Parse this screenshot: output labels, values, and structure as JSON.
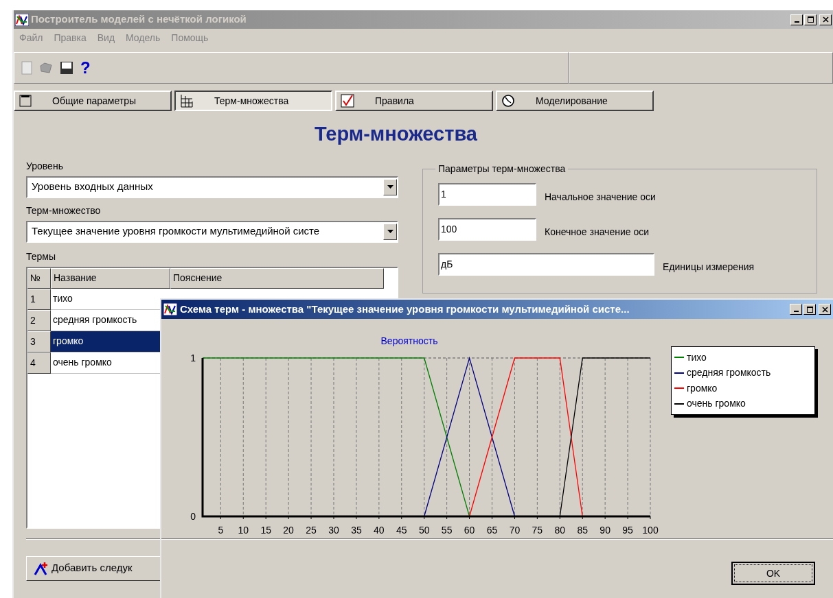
{
  "window": {
    "title": "Построитель моделей с нечёткой логикой"
  },
  "menu": [
    "Файл",
    "Правка",
    "Вид",
    "Модель",
    "Помощь"
  ],
  "toolbar": {
    "help": "?"
  },
  "tabs": [
    {
      "label": "Общие параметры",
      "selected": false,
      "kind": "window"
    },
    {
      "label": "Терм-множества",
      "selected": true,
      "kind": "table"
    },
    {
      "label": "Правила",
      "selected": false,
      "kind": "check"
    },
    {
      "label": "Моделирование",
      "selected": false,
      "kind": "clock"
    }
  ],
  "heading": "Терм-множества",
  "level": {
    "label": "Уровень",
    "value": "Уровень входных данных"
  },
  "term_set": {
    "label": "Терм-множество",
    "value": "Текущее значение уровня громкости мультимедийной систе"
  },
  "terms": {
    "label": "Термы",
    "columns": [
      "№",
      "Название",
      "Пояснение"
    ],
    "rows": [
      {
        "number": "1",
        "name": "тихо",
        "selected": false
      },
      {
        "number": "2",
        "name": "средняя громкость",
        "selected": false
      },
      {
        "number": "3",
        "name": "громко",
        "selected": true
      },
      {
        "number": "4",
        "name": "очень громко",
        "selected": false
      }
    ]
  },
  "params": {
    "title": "Параметры терм-множества",
    "fields": [
      {
        "value": "1",
        "label": "Начальное значение оси",
        "kind": "short"
      },
      {
        "value": "100",
        "label": "Конечное значение оси",
        "kind": "short"
      },
      {
        "value": "дБ",
        "label": "Единицы измерения",
        "kind": "long"
      }
    ]
  },
  "add_button": "Добавить следук",
  "dialog": {
    "title": "Схема терм - множества \"Текущее значение уровня громкости мультимедийной систе...",
    "ok": "OK",
    "chart_data": {
      "type": "line",
      "title": "Вероятность",
      "x": [
        1,
        50,
        60,
        70,
        80,
        85,
        100
      ],
      "xlim": [
        1,
        100
      ],
      "ylim": [
        0,
        1
      ],
      "grid": true,
      "xticks": [
        5,
        10,
        15,
        20,
        25,
        30,
        35,
        40,
        45,
        50,
        55,
        60,
        65,
        70,
        75,
        80,
        85,
        90,
        95,
        100
      ],
      "yticks": [
        0,
        1
      ],
      "series": [
        {
          "name": "тихо",
          "color": "#008000",
          "values": [
            1,
            1,
            0,
            null,
            null,
            null,
            null
          ]
        },
        {
          "name": "средняя громкость",
          "color": "#000080",
          "values": [
            null,
            0,
            1,
            0,
            null,
            null,
            null
          ]
        },
        {
          "name": "громко",
          "color": "#ff0000",
          "values": [
            null,
            null,
            0,
            1,
            1,
            0,
            null
          ]
        },
        {
          "name": "очень громко",
          "color": "#000000",
          "values": [
            null,
            null,
            null,
            null,
            0,
            1,
            1
          ]
        }
      ]
    }
  }
}
